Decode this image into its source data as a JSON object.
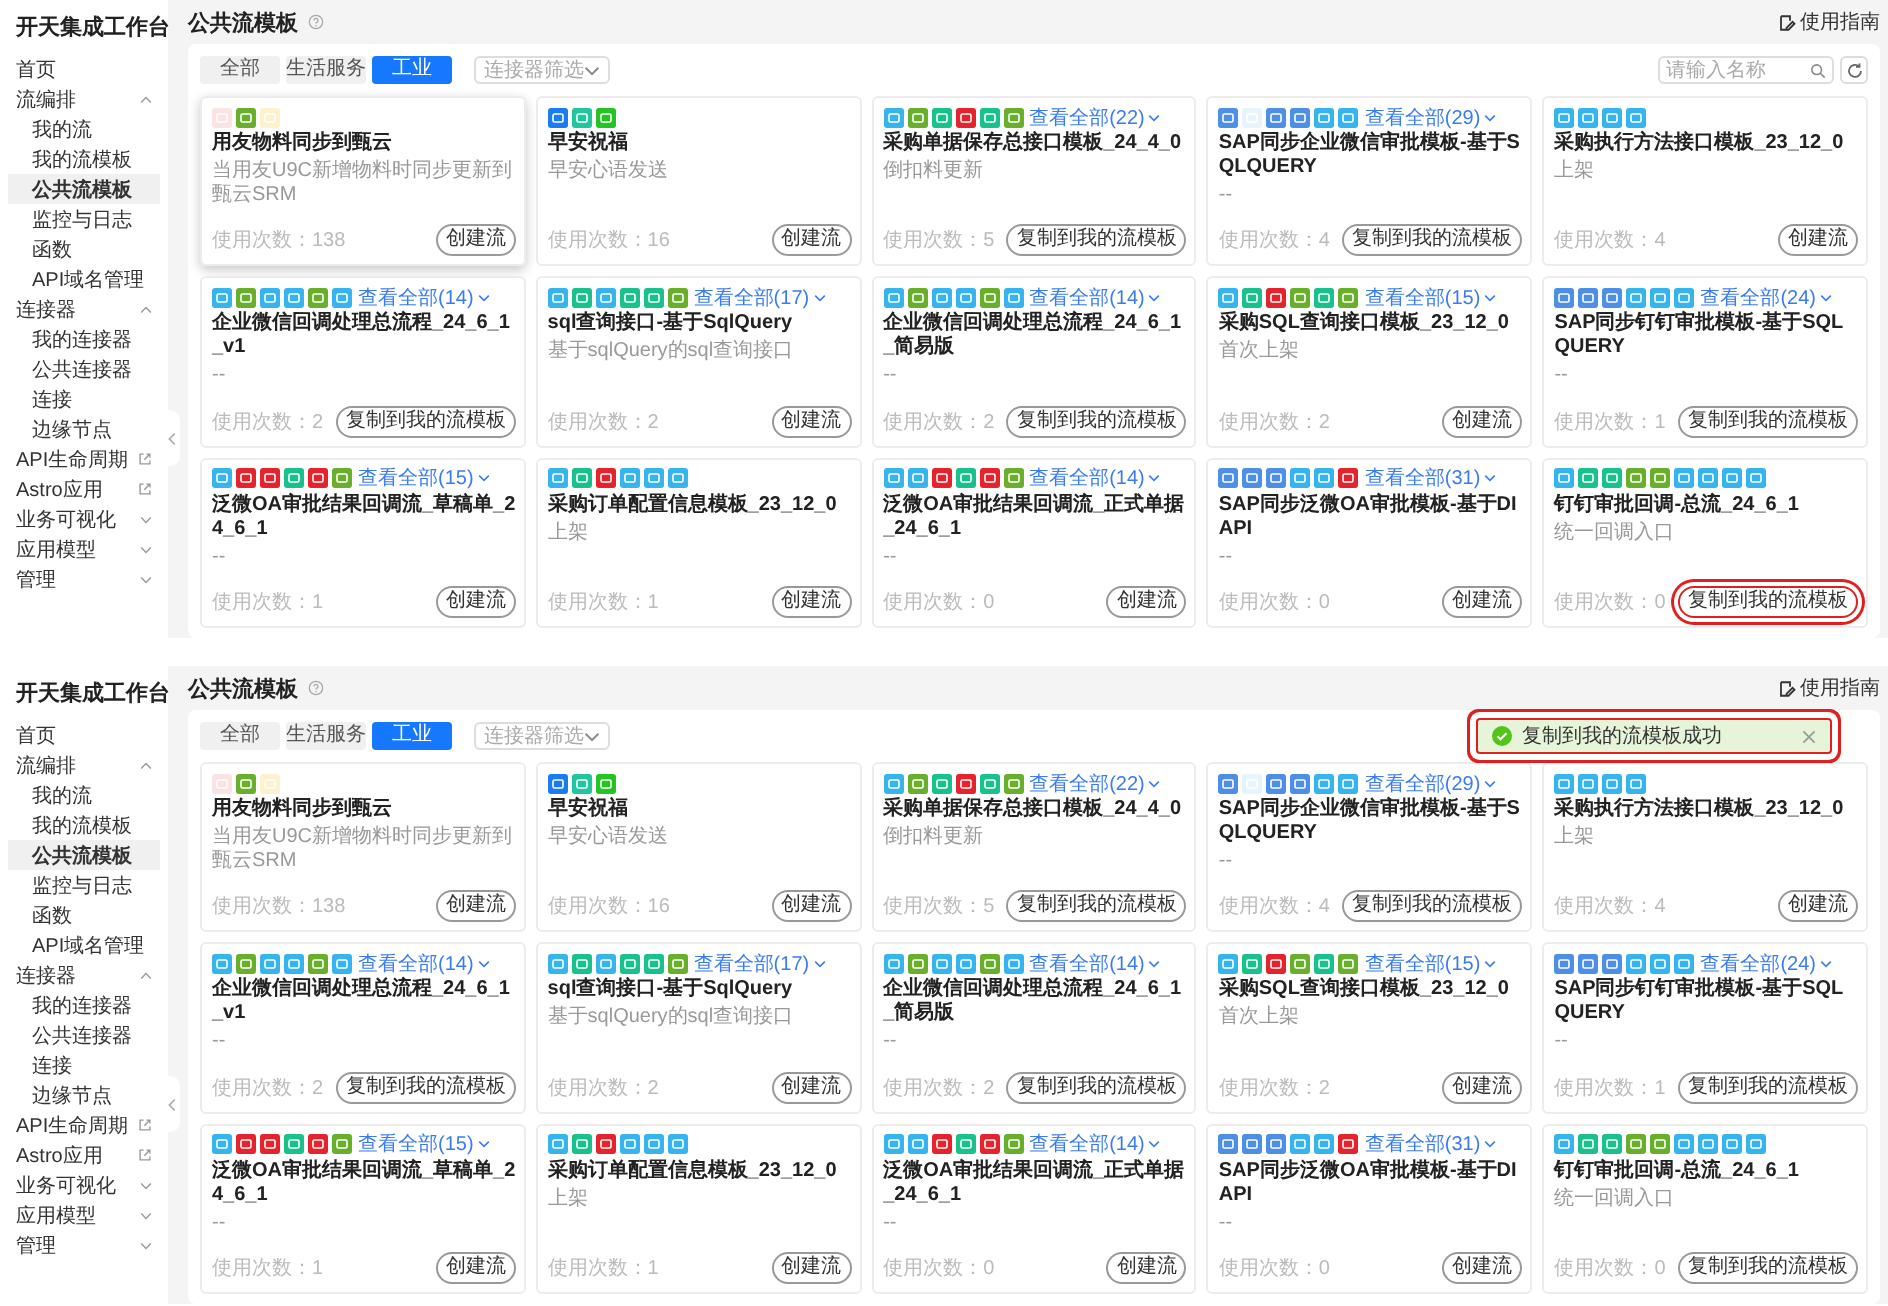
{
  "screenshots": [
    {
      "sidebar": {
        "title": "开天集成工作台",
        "items": [
          {
            "label": "首页",
            "kind": "plain",
            "selected": false
          },
          {
            "label": "流编排",
            "kind": "group",
            "expanded": true,
            "selected": false,
            "children": [
              {
                "label": "我的流",
                "selected": false
              },
              {
                "label": "我的流模板",
                "selected": false
              },
              {
                "label": "公共流模板",
                "selected": true
              },
              {
                "label": "监控与日志",
                "selected": false
              },
              {
                "label": "函数",
                "selected": false
              },
              {
                "label": "API域名管理",
                "selected": false
              }
            ]
          },
          {
            "label": "连接器",
            "kind": "group",
            "expanded": true,
            "selected": false,
            "children": [
              {
                "label": "我的连接器",
                "selected": false
              },
              {
                "label": "公共连接器",
                "selected": false
              },
              {
                "label": "连接",
                "selected": false
              },
              {
                "label": "边缘节点",
                "selected": false
              }
            ]
          },
          {
            "label": "API生命周期",
            "kind": "external",
            "selected": false
          },
          {
            "label": "Astro应用",
            "kind": "external",
            "selected": false
          },
          {
            "label": "业务可视化",
            "kind": "group",
            "expanded": false,
            "selected": false
          },
          {
            "label": "应用模型",
            "kind": "group",
            "expanded": false,
            "selected": false
          },
          {
            "label": "管理",
            "kind": "group",
            "expanded": false,
            "selected": false
          }
        ]
      },
      "header": {
        "title": "公共流模板",
        "guide": "使用指南"
      },
      "tabs": [
        {
          "label": "全部",
          "selected": false
        },
        {
          "label": "生活服务",
          "selected": false
        },
        {
          "label": "工业",
          "selected": true
        }
      ],
      "filter": {
        "placeholder": "连接器筛选"
      },
      "search": {
        "placeholder": "请输入名称"
      },
      "cards": [
        {
          "raised": true,
          "button_highlighted": false,
          "icons": [
            {
              "color": "#fbe3e3"
            },
            {
              "color": "#6aaf2c"
            },
            {
              "color": "#fff1cc"
            }
          ],
          "title": "用友物料同步到甄云",
          "desc": "当用友U9C新增物料时同步更新到甄云SRM",
          "usage": "使用次数：138",
          "button": "创建流"
        },
        {
          "raised": false,
          "button_highlighted": false,
          "icons": [
            {
              "color": "#1a7cf5"
            },
            {
              "color": "#1fc6a0"
            },
            {
              "color": "#25c425"
            }
          ],
          "title": "早安祝福",
          "desc": "早安心语发送",
          "usage": "使用次数：16",
          "button": "创建流"
        },
        {
          "raised": false,
          "button_highlighted": false,
          "icons": [
            {
              "color": "#36b4f0"
            },
            {
              "color": "#6aaf2c"
            },
            {
              "color": "#19c28c"
            },
            {
              "color": "#e5232d"
            },
            {
              "color": "#19c28c"
            },
            {
              "color": "#6aaf2c"
            }
          ],
          "more": "查看全部(22)",
          "title": "采购单据保存总接口模板_24_4_0",
          "desc": "倒扣料更新",
          "usage": "使用次数：5",
          "button": "复制到我的流模板"
        },
        {
          "raised": false,
          "button_highlighted": false,
          "icons": [
            {
              "color": "#4d8fe6"
            },
            {
              "color": "#e8f4fd"
            },
            {
              "color": "#4d8fe6"
            },
            {
              "color": "#4d8fe6"
            },
            {
              "color": "#36b4f0"
            },
            {
              "color": "#36b4f0"
            }
          ],
          "more": "查看全部(29)",
          "title": "SAP同步企业微信审批模板-基于SQLQUERY",
          "desc": "--",
          "usage": "使用次数：4",
          "button": "复制到我的流模板"
        },
        {
          "raised": false,
          "button_highlighted": false,
          "icons": [
            {
              "color": "#36b4f0"
            },
            {
              "color": "#36b4f0"
            },
            {
              "color": "#36b4f0"
            },
            {
              "color": "#36b4f0"
            }
          ],
          "title": "采购执行方法接口模板_23_12_0",
          "desc": "上架",
          "usage": "使用次数：4",
          "button": "创建流"
        },
        {
          "raised": false,
          "button_highlighted": false,
          "icons": [
            {
              "color": "#36b4f0"
            },
            {
              "color": "#6aaf2c"
            },
            {
              "color": "#36b4f0"
            },
            {
              "color": "#36b4f0"
            },
            {
              "color": "#6aaf2c"
            },
            {
              "color": "#36b4f0"
            }
          ],
          "more": "查看全部(14)",
          "title": "企业微信回调处理总流程_24_6_1_v1",
          "desc": "--",
          "usage": "使用次数：2",
          "button": "复制到我的流模板"
        },
        {
          "raised": false,
          "button_highlighted": false,
          "icons": [
            {
              "color": "#36b4f0"
            },
            {
              "color": "#19c28c"
            },
            {
              "color": "#36b4f0"
            },
            {
              "color": "#19c28c"
            },
            {
              "color": "#19c28c"
            },
            {
              "color": "#6aaf2c"
            }
          ],
          "more": "查看全部(17)",
          "title": "sql查询接口-基于SqlQuery",
          "desc": "基于sqlQuery的sql查询接口",
          "usage": "使用次数：2",
          "button": "创建流"
        },
        {
          "raised": false,
          "button_highlighted": false,
          "icons": [
            {
              "color": "#36b4f0"
            },
            {
              "color": "#6aaf2c"
            },
            {
              "color": "#36b4f0"
            },
            {
              "color": "#36b4f0"
            },
            {
              "color": "#6aaf2c"
            },
            {
              "color": "#36b4f0"
            }
          ],
          "more": "查看全部(14)",
          "title": "企业微信回调处理总流程_24_6_1_简易版",
          "desc": "--",
          "usage": "使用次数：2",
          "button": "复制到我的流模板"
        },
        {
          "raised": false,
          "button_highlighted": false,
          "icons": [
            {
              "color": "#36b4f0"
            },
            {
              "color": "#19c28c"
            },
            {
              "color": "#e5232d"
            },
            {
              "color": "#6aaf2c"
            },
            {
              "color": "#19c28c"
            },
            {
              "color": "#6aaf2c"
            }
          ],
          "more": "查看全部(15)",
          "title": "采购SQL查询接口模板_23_12_0",
          "desc": "首次上架",
          "usage": "使用次数：2",
          "button": "创建流"
        },
        {
          "raised": false,
          "button_highlighted": false,
          "icons": [
            {
              "color": "#4d8fe6"
            },
            {
              "color": "#4d8fe6"
            },
            {
              "color": "#4d8fe6"
            },
            {
              "color": "#36b4f0"
            },
            {
              "color": "#36b4f0"
            },
            {
              "color": "#36b4f0"
            }
          ],
          "more": "查看全部(24)",
          "title": "SAP同步钉钉审批模板-基于SQLQUERY",
          "desc": "--",
          "usage": "使用次数：1",
          "button": "复制到我的流模板"
        },
        {
          "raised": false,
          "button_highlighted": false,
          "icons": [
            {
              "color": "#36b4f0"
            },
            {
              "color": "#e5232d"
            },
            {
              "color": "#e5232d"
            },
            {
              "color": "#19c28c"
            },
            {
              "color": "#e5232d"
            },
            {
              "color": "#6aaf2c"
            }
          ],
          "more": "查看全部(15)",
          "title": "泛微OA审批结果回调流_草稿单_24_6_1",
          "desc": "--",
          "usage": "使用次数：1",
          "button": "创建流"
        },
        {
          "raised": false,
          "button_highlighted": false,
          "icons": [
            {
              "color": "#36b4f0"
            },
            {
              "color": "#19c28c"
            },
            {
              "color": "#e5232d"
            },
            {
              "color": "#36b4f0"
            },
            {
              "color": "#36b4f0"
            },
            {
              "color": "#36b4f0"
            }
          ],
          "title": "采购订单配置信息模板_23_12_0",
          "desc": "上架",
          "usage": "使用次数：1",
          "button": "创建流"
        },
        {
          "raised": false,
          "button_highlighted": false,
          "icons": [
            {
              "color": "#36b4f0"
            },
            {
              "color": "#36b4f0"
            },
            {
              "color": "#e5232d"
            },
            {
              "color": "#19c28c"
            },
            {
              "color": "#e5232d"
            },
            {
              "color": "#6aaf2c"
            }
          ],
          "more": "查看全部(14)",
          "title": "泛微OA审批结果回调流_正式单据_24_6_1",
          "desc": "--",
          "usage": "使用次数：0",
          "button": "创建流"
        },
        {
          "raised": false,
          "button_highlighted": false,
          "icons": [
            {
              "color": "#4d8fe6"
            },
            {
              "color": "#4d8fe6"
            },
            {
              "color": "#4d8fe6"
            },
            {
              "color": "#36b4f0"
            },
            {
              "color": "#36b4f0"
            },
            {
              "color": "#e5232d"
            }
          ],
          "more": "查看全部(31)",
          "title": "SAP同步泛微OA审批模板-基于DIAPI",
          "desc": "--",
          "usage": "使用次数：0",
          "button": "创建流"
        },
        {
          "raised": false,
          "button_highlighted": true,
          "icons": [
            {
              "color": "#36b4f0"
            },
            {
              "color": "#19c28c"
            },
            {
              "color": "#19c28c"
            },
            {
              "color": "#6aaf2c"
            },
            {
              "color": "#6aaf2c"
            },
            {
              "color": "#36b4f0"
            },
            {
              "color": "#36b4f0"
            },
            {
              "color": "#36b4f0"
            },
            {
              "color": "#36b4f0"
            }
          ],
          "title": "钉钉审批回调-总流_24_6_1",
          "desc": "统一回调入口",
          "usage": "使用次数：0",
          "button": "复制到我的流模板"
        }
      ]
    },
    {
      "sidebar": {
        "title": "开天集成工作台",
        "items": [
          {
            "label": "首页",
            "kind": "plain",
            "selected": false
          },
          {
            "label": "流编排",
            "kind": "group",
            "expanded": true,
            "selected": false,
            "children": [
              {
                "label": "我的流",
                "selected": false
              },
              {
                "label": "我的流模板",
                "selected": false
              },
              {
                "label": "公共流模板",
                "selected": true
              },
              {
                "label": "监控与日志",
                "selected": false
              },
              {
                "label": "函数",
                "selected": false
              },
              {
                "label": "API域名管理",
                "selected": false
              }
            ]
          },
          {
            "label": "连接器",
            "kind": "group",
            "expanded": true,
            "selected": false,
            "children": [
              {
                "label": "我的连接器",
                "selected": false
              },
              {
                "label": "公共连接器",
                "selected": false
              },
              {
                "label": "连接",
                "selected": false
              },
              {
                "label": "边缘节点",
                "selected": false
              }
            ]
          },
          {
            "label": "API生命周期",
            "kind": "external",
            "selected": false
          },
          {
            "label": "Astro应用",
            "kind": "external",
            "selected": false
          },
          {
            "label": "业务可视化",
            "kind": "group",
            "expanded": false,
            "selected": false
          },
          {
            "label": "应用模型",
            "kind": "group",
            "expanded": false,
            "selected": false
          },
          {
            "label": "管理",
            "kind": "group",
            "expanded": false,
            "selected": false
          }
        ]
      },
      "header": {
        "title": "公共流模板",
        "guide": "使用指南"
      },
      "tabs": [
        {
          "label": "全部",
          "selected": false
        },
        {
          "label": "生活服务",
          "selected": false
        },
        {
          "label": "工业",
          "selected": true
        }
      ],
      "filter": {
        "placeholder": "连接器筛选"
      },
      "toast": {
        "text": "复制到我的流模板成功",
        "highlighted": true
      },
      "cards": [
        {
          "raised": false,
          "button_highlighted": false,
          "icons": [
            {
              "color": "#fbe3e3"
            },
            {
              "color": "#6aaf2c"
            },
            {
              "color": "#fff1cc"
            }
          ],
          "title": "用友物料同步到甄云",
          "desc": "当用友U9C新增物料时同步更新到甄云SRM",
          "usage": "使用次数：138",
          "button": "创建流"
        },
        {
          "raised": false,
          "button_highlighted": false,
          "icons": [
            {
              "color": "#1a7cf5"
            },
            {
              "color": "#1fc6a0"
            },
            {
              "color": "#25c425"
            }
          ],
          "title": "早安祝福",
          "desc": "早安心语发送",
          "usage": "使用次数：16",
          "button": "创建流"
        },
        {
          "raised": false,
          "button_highlighted": false,
          "icons": [
            {
              "color": "#36b4f0"
            },
            {
              "color": "#6aaf2c"
            },
            {
              "color": "#19c28c"
            },
            {
              "color": "#e5232d"
            },
            {
              "color": "#19c28c"
            },
            {
              "color": "#6aaf2c"
            }
          ],
          "more": "查看全部(22)",
          "title": "采购单据保存总接口模板_24_4_0",
          "desc": "倒扣料更新",
          "usage": "使用次数：5",
          "button": "复制到我的流模板"
        },
        {
          "raised": false,
          "button_highlighted": false,
          "icons": [
            {
              "color": "#4d8fe6"
            },
            {
              "color": "#e8f4fd"
            },
            {
              "color": "#4d8fe6"
            },
            {
              "color": "#4d8fe6"
            },
            {
              "color": "#36b4f0"
            },
            {
              "color": "#36b4f0"
            }
          ],
          "more": "查看全部(29)",
          "title": "SAP同步企业微信审批模板-基于SQLQUERY",
          "desc": "--",
          "usage": "使用次数：4",
          "button": "复制到我的流模板"
        },
        {
          "raised": false,
          "button_highlighted": false,
          "icons": [
            {
              "color": "#36b4f0"
            },
            {
              "color": "#36b4f0"
            },
            {
              "color": "#36b4f0"
            },
            {
              "color": "#36b4f0"
            }
          ],
          "title": "采购执行方法接口模板_23_12_0",
          "desc": "上架",
          "usage": "使用次数：4",
          "button": "创建流"
        },
        {
          "raised": false,
          "button_highlighted": false,
          "icons": [
            {
              "color": "#36b4f0"
            },
            {
              "color": "#6aaf2c"
            },
            {
              "color": "#36b4f0"
            },
            {
              "color": "#36b4f0"
            },
            {
              "color": "#6aaf2c"
            },
            {
              "color": "#36b4f0"
            }
          ],
          "more": "查看全部(14)",
          "title": "企业微信回调处理总流程_24_6_1_v1",
          "desc": "--",
          "usage": "使用次数：2",
          "button": "复制到我的流模板"
        },
        {
          "raised": false,
          "button_highlighted": false,
          "icons": [
            {
              "color": "#36b4f0"
            },
            {
              "color": "#19c28c"
            },
            {
              "color": "#36b4f0"
            },
            {
              "color": "#19c28c"
            },
            {
              "color": "#19c28c"
            },
            {
              "color": "#6aaf2c"
            }
          ],
          "more": "查看全部(17)",
          "title": "sql查询接口-基于SqlQuery",
          "desc": "基于sqlQuery的sql查询接口",
          "usage": "使用次数：2",
          "button": "创建流"
        },
        {
          "raised": false,
          "button_highlighted": false,
          "icons": [
            {
              "color": "#36b4f0"
            },
            {
              "color": "#6aaf2c"
            },
            {
              "color": "#36b4f0"
            },
            {
              "color": "#36b4f0"
            },
            {
              "color": "#6aaf2c"
            },
            {
              "color": "#36b4f0"
            }
          ],
          "more": "查看全部(14)",
          "title": "企业微信回调处理总流程_24_6_1_简易版",
          "desc": "--",
          "usage": "使用次数：2",
          "button": "复制到我的流模板"
        },
        {
          "raised": false,
          "button_highlighted": false,
          "icons": [
            {
              "color": "#36b4f0"
            },
            {
              "color": "#19c28c"
            },
            {
              "color": "#e5232d"
            },
            {
              "color": "#6aaf2c"
            },
            {
              "color": "#19c28c"
            },
            {
              "color": "#6aaf2c"
            }
          ],
          "more": "查看全部(15)",
          "title": "采购SQL查询接口模板_23_12_0",
          "desc": "首次上架",
          "usage": "使用次数：2",
          "button": "创建流"
        },
        {
          "raised": false,
          "button_highlighted": false,
          "icons": [
            {
              "color": "#4d8fe6"
            },
            {
              "color": "#4d8fe6"
            },
            {
              "color": "#4d8fe6"
            },
            {
              "color": "#36b4f0"
            },
            {
              "color": "#36b4f0"
            },
            {
              "color": "#36b4f0"
            }
          ],
          "more": "查看全部(24)",
          "title": "SAP同步钉钉审批模板-基于SQLQUERY",
          "desc": "--",
          "usage": "使用次数：1",
          "button": "复制到我的流模板"
        },
        {
          "raised": false,
          "button_highlighted": false,
          "icons": [
            {
              "color": "#36b4f0"
            },
            {
              "color": "#e5232d"
            },
            {
              "color": "#e5232d"
            },
            {
              "color": "#19c28c"
            },
            {
              "color": "#e5232d"
            },
            {
              "color": "#6aaf2c"
            }
          ],
          "more": "查看全部(15)",
          "title": "泛微OA审批结果回调流_草稿单_24_6_1",
          "desc": "--",
          "usage": "使用次数：1",
          "button": "创建流"
        },
        {
          "raised": false,
          "button_highlighted": false,
          "icons": [
            {
              "color": "#36b4f0"
            },
            {
              "color": "#19c28c"
            },
            {
              "color": "#e5232d"
            },
            {
              "color": "#36b4f0"
            },
            {
              "color": "#36b4f0"
            },
            {
              "color": "#36b4f0"
            }
          ],
          "title": "采购订单配置信息模板_23_12_0",
          "desc": "上架",
          "usage": "使用次数：1",
          "button": "创建流"
        },
        {
          "raised": false,
          "button_highlighted": false,
          "icons": [
            {
              "color": "#36b4f0"
            },
            {
              "color": "#36b4f0"
            },
            {
              "color": "#e5232d"
            },
            {
              "color": "#19c28c"
            },
            {
              "color": "#e5232d"
            },
            {
              "color": "#6aaf2c"
            }
          ],
          "more": "查看全部(14)",
          "title": "泛微OA审批结果回调流_正式单据_24_6_1",
          "desc": "--",
          "usage": "使用次数：0",
          "button": "创建流"
        },
        {
          "raised": false,
          "button_highlighted": false,
          "icons": [
            {
              "color": "#4d8fe6"
            },
            {
              "color": "#4d8fe6"
            },
            {
              "color": "#4d8fe6"
            },
            {
              "color": "#36b4f0"
            },
            {
              "color": "#36b4f0"
            },
            {
              "color": "#e5232d"
            }
          ],
          "more": "查看全部(31)",
          "title": "SAP同步泛微OA审批模板-基于DIAPI",
          "desc": "--",
          "usage": "使用次数：0",
          "button": "创建流"
        },
        {
          "raised": false,
          "button_highlighted": false,
          "icons": [
            {
              "color": "#36b4f0"
            },
            {
              "color": "#19c28c"
            },
            {
              "color": "#19c28c"
            },
            {
              "color": "#6aaf2c"
            },
            {
              "color": "#6aaf2c"
            },
            {
              "color": "#36b4f0"
            },
            {
              "color": "#36b4f0"
            },
            {
              "color": "#36b4f0"
            },
            {
              "color": "#36b4f0"
            }
          ],
          "title": "钉钉审批回调-总流_24_6_1",
          "desc": "统一回调入口",
          "usage": "使用次数：0",
          "button": "复制到我的流模板"
        }
      ]
    }
  ]
}
